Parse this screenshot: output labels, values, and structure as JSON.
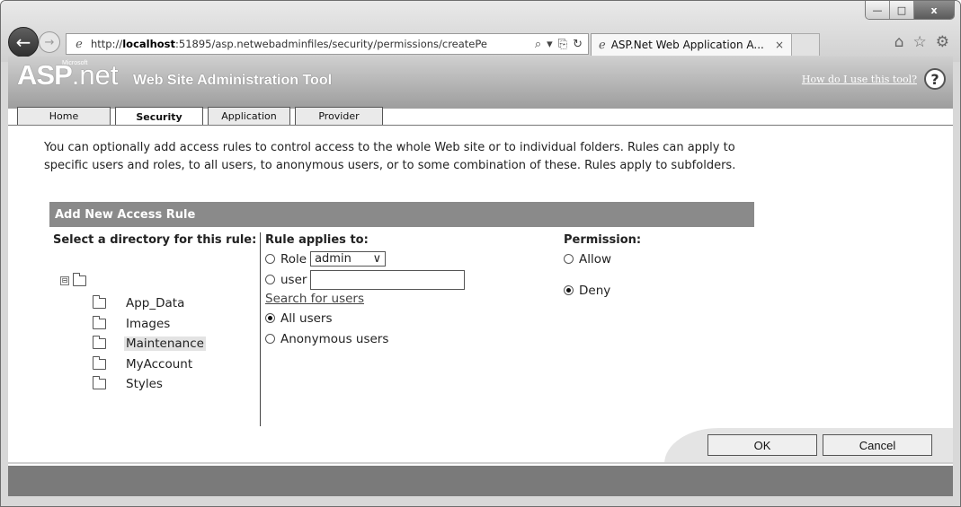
{
  "browser": {
    "url_prefix": "http://",
    "url_host": "localhost",
    "url_rest": ":51895/asp.netwebadminfiles/security/permissions/createPe",
    "tab_title": "ASP.Net Web Application A...",
    "tab_close": "×",
    "window_controls": {
      "minimize": "—",
      "maximize": "□",
      "close": "x"
    }
  },
  "header": {
    "logo_asp": "ASP",
    "logo_net": ".net",
    "logo_ms": "Microsoft",
    "title": "Web Site Administration Tool",
    "help_link": "How do I use this tool?",
    "help_icon": "?"
  },
  "tabs": [
    {
      "label": "Home"
    },
    {
      "label": "Security",
      "active": true
    },
    {
      "label": "Application"
    },
    {
      "label": "Provider"
    }
  ],
  "intro_text": "You can optionally add access rules to control access to the whole Web site or to individual folders. Rules can apply to specific users and roles, to all users, to anonymous users, or to some combination of these. Rules apply to subfolders.",
  "panel": {
    "title": "Add New Access Rule",
    "directory": {
      "title": "Select a directory for this rule:",
      "expander": "⊟",
      "folders": [
        {
          "name": "App_Data"
        },
        {
          "name": "Images"
        },
        {
          "name": "Maintenance",
          "selected": true
        },
        {
          "name": "MyAccount"
        },
        {
          "name": "Styles"
        }
      ]
    },
    "rule": {
      "title": "Rule applies to:",
      "role_label": "Role",
      "role_value": "admin",
      "user_label": "user",
      "user_value": "",
      "search_link": "Search for users",
      "all_users": "All users",
      "anonymous_users": "Anonymous users",
      "selected": "all_users"
    },
    "permission": {
      "title": "Permission:",
      "allow": "Allow",
      "deny": "Deny",
      "selected": "deny"
    }
  },
  "buttons": {
    "ok": "OK",
    "cancel": "Cancel"
  }
}
